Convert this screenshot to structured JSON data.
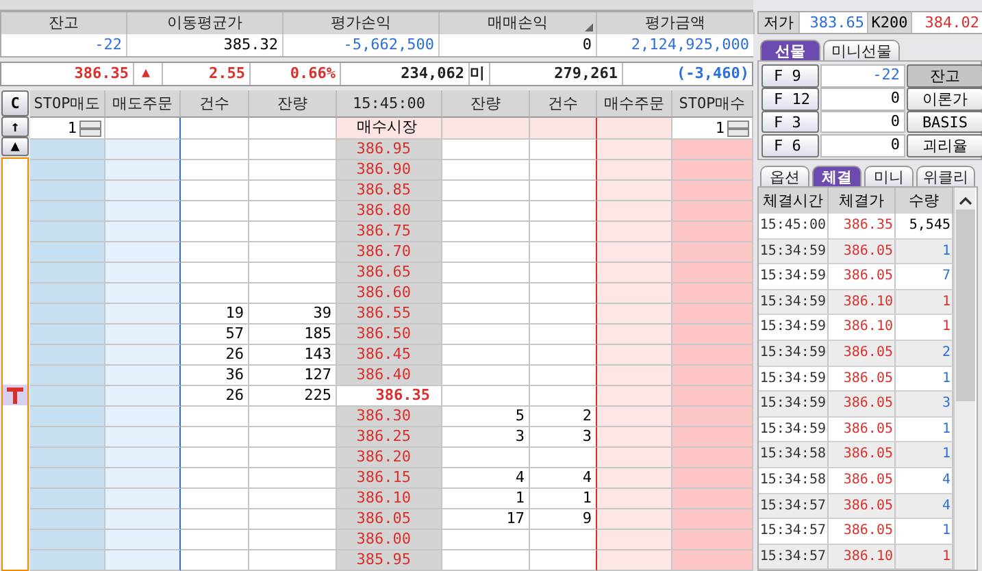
{
  "position": {
    "columns": [
      {
        "label": "잔고",
        "value": "-22",
        "color": "#2a6fdb",
        "corner_mark": false
      },
      {
        "label": "이동평균가",
        "value": "385.32",
        "color": "#000000",
        "corner_mark": false
      },
      {
        "label": "평가손익",
        "value": "-5,662,500",
        "color": "#2a6fdb",
        "corner_mark": false
      },
      {
        "label": "매매손익",
        "value": "0",
        "color": "#000000",
        "corner_mark": true
      },
      {
        "label": "평가금액",
        "value": "2,124,925,000",
        "color": "#2a6fdb",
        "corner_mark": false
      }
    ]
  },
  "quote": {
    "price": "386.35",
    "color": "#d9302c",
    "arrow": "▲",
    "change": "2.55",
    "rate": "0.66%",
    "volume": "234,062",
    "oi_label": "미",
    "open_interest": "279,261",
    "oi_change": {
      "value": "(-3,460)",
      "color": "#2a6fdb"
    }
  },
  "orderbook": {
    "clear_button": "C",
    "up_button": "↑",
    "top_button": "▲",
    "columns": [
      "STOP매도",
      "매도주문",
      "건수",
      "잔량",
      "15:45:00",
      "잔량",
      "건수",
      "매수주문",
      "STOP매수"
    ],
    "stop_sell_qty": "1",
    "market_label": "매수시장",
    "stop_buy_qty": "1",
    "rows": [
      {
        "price": "386.95",
        "current": false
      },
      {
        "price": "386.90",
        "current": false
      },
      {
        "price": "386.85",
        "current": false
      },
      {
        "price": "386.80",
        "current": false
      },
      {
        "price": "386.75",
        "current": false
      },
      {
        "price": "386.70",
        "current": false
      },
      {
        "price": "386.65",
        "current": false
      },
      {
        "price": "386.60",
        "current": false
      },
      {
        "price": "386.55",
        "current": false,
        "ask_count": "19",
        "ask_qty": "39"
      },
      {
        "price": "386.50",
        "current": false,
        "ask_count": "57",
        "ask_qty": "185"
      },
      {
        "price": "386.45",
        "current": false,
        "ask_count": "26",
        "ask_qty": "143"
      },
      {
        "price": "386.40",
        "current": false,
        "ask_count": "36",
        "ask_qty": "127"
      },
      {
        "price": "386.35",
        "current": true,
        "ask_count": "26",
        "ask_qty": "225"
      },
      {
        "price": "386.30",
        "current": false,
        "bid_qty": "5",
        "bid_count": "2"
      },
      {
        "price": "386.25",
        "current": false,
        "bid_qty": "3",
        "bid_count": "3"
      },
      {
        "price": "386.20",
        "current": false
      },
      {
        "price": "386.15",
        "current": false,
        "bid_qty": "4",
        "bid_count": "4"
      },
      {
        "price": "386.10",
        "current": false,
        "bid_qty": "1",
        "bid_count": "1"
      },
      {
        "price": "386.05",
        "current": false,
        "bid_qty": "17",
        "bid_count": "9"
      },
      {
        "price": "386.00",
        "current": false
      },
      {
        "price": "385.95",
        "current": false
      }
    ]
  },
  "range": [
    {
      "label": "저가",
      "value": "383.65",
      "color": "#2a6fdb"
    },
    {
      "label": "K200",
      "value": "384.02",
      "color": "#d9302c"
    }
  ],
  "futures_tabs": [
    {
      "label": "선물",
      "selected": true
    },
    {
      "label": "미니선물",
      "selected": false
    }
  ],
  "futures_rows": [
    {
      "code": "F 9",
      "value": "-22",
      "color": "#2a6fdb",
      "action": "잔고",
      "pressed": true
    },
    {
      "code": "F 12",
      "value": "0",
      "color": "#000000",
      "action": "이론가",
      "pressed": false
    },
    {
      "code": "F 3",
      "value": "0",
      "color": "#000000",
      "action": "BASIS",
      "pressed": false
    },
    {
      "code": "F 6",
      "value": "0",
      "color": "#000000",
      "action": "괴리율",
      "pressed": false
    }
  ],
  "trade_tabs": [
    {
      "label": "옵션",
      "selected": false
    },
    {
      "label": "체결",
      "selected": true
    },
    {
      "label": "미니",
      "selected": false
    },
    {
      "label": "위클리",
      "selected": false
    }
  ],
  "trades": {
    "columns": [
      "체결시간",
      "체결가",
      "수량"
    ],
    "rows": [
      {
        "time": "15:45:00",
        "price": "386.35",
        "qty": "5,545",
        "color": "#000000"
      },
      {
        "time": "15:34:59",
        "price": "386.05",
        "qty": "1",
        "color": "#2a6fdb"
      },
      {
        "time": "15:34:59",
        "price": "386.05",
        "qty": "7",
        "color": "#2a6fdb"
      },
      {
        "time": "15:34:59",
        "price": "386.10",
        "qty": "1",
        "color": "#d9302c"
      },
      {
        "time": "15:34:59",
        "price": "386.10",
        "qty": "1",
        "color": "#d9302c"
      },
      {
        "time": "15:34:59",
        "price": "386.05",
        "qty": "2",
        "color": "#2a6fdb"
      },
      {
        "time": "15:34:59",
        "price": "386.05",
        "qty": "1",
        "color": "#2a6fdb"
      },
      {
        "time": "15:34:59",
        "price": "386.05",
        "qty": "3",
        "color": "#2a6fdb"
      },
      {
        "time": "15:34:59",
        "price": "386.05",
        "qty": "1",
        "color": "#2a6fdb"
      },
      {
        "time": "15:34:58",
        "price": "386.05",
        "qty": "1",
        "color": "#2a6fdb"
      },
      {
        "time": "15:34:58",
        "price": "386.05",
        "qty": "4",
        "color": "#2a6fdb"
      },
      {
        "time": "15:34:57",
        "price": "386.05",
        "qty": "4",
        "color": "#2a6fdb"
      },
      {
        "time": "15:34:57",
        "price": "386.05",
        "qty": "1",
        "color": "#2a6fdb"
      },
      {
        "time": "15:34:57",
        "price": "386.10",
        "qty": "1",
        "color": "#d9302c"
      }
    ]
  }
}
